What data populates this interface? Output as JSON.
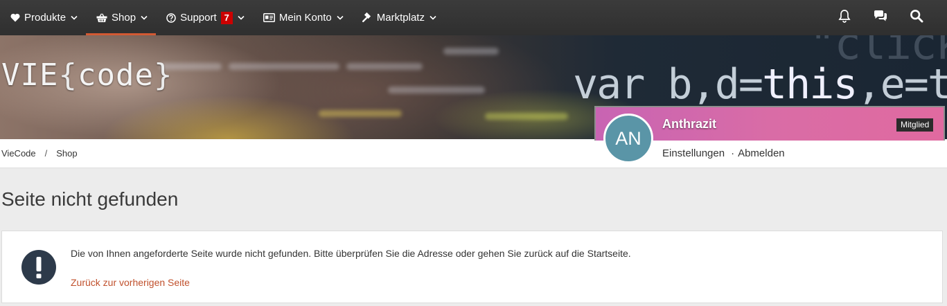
{
  "nav": {
    "items": [
      {
        "label": "Produkte",
        "icon": "heart-icon"
      },
      {
        "label": "Shop",
        "icon": "basket-icon",
        "active": true
      },
      {
        "label": "Support",
        "icon": "question-circle-icon",
        "badge": "7"
      },
      {
        "label": "Mein Konto",
        "icon": "id-card-icon"
      },
      {
        "label": "Marktplatz",
        "icon": "gavel-icon"
      }
    ],
    "right_icons": [
      "bell-icon",
      "chat-icon",
      "search-icon"
    ],
    "accent": "#d35933",
    "badge_color": "#cc0000"
  },
  "banner": {
    "logo_left": "VIE",
    "logo_brace_open": "{",
    "logo_word": "code",
    "logo_brace_close": "}"
  },
  "breadcrumb": {
    "items": [
      "VieCode",
      "Shop"
    ],
    "separator": "/"
  },
  "user": {
    "initials": "AN",
    "name": "Anthrazit",
    "role_badge": "Mitglied",
    "links": [
      "Einstellungen",
      "Abmelden"
    ],
    "link_separator": "·",
    "avatar_color": "#5a95a7"
  },
  "main": {
    "title": "Seite nicht gefunden",
    "message": "Die von Ihnen angeforderte Seite wurde nicht gefunden. Bitte überprüfen Sie die Adresse oder gehen Sie zurück auf die Startseite.",
    "back_link": "Zurück zur vorherigen Seite",
    "icon": "exclamation-icon",
    "link_color": "#c0502c"
  }
}
